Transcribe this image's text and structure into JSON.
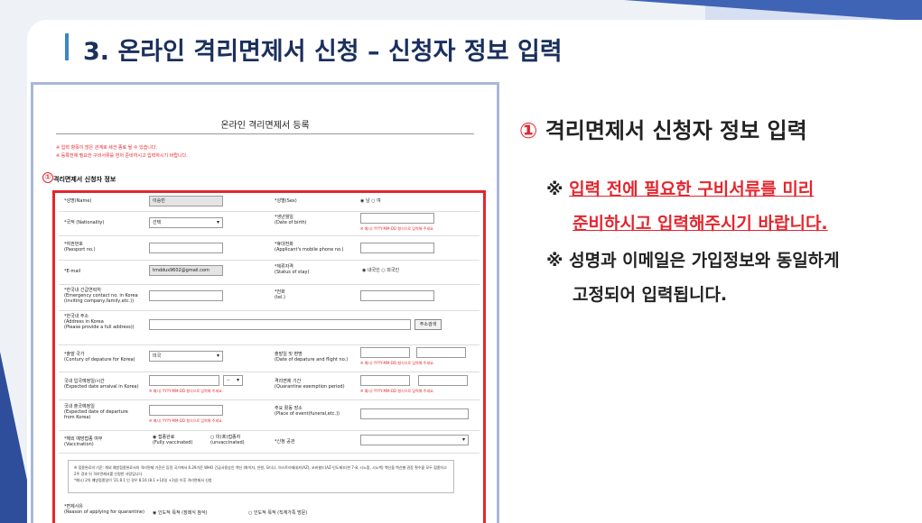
{
  "title": "3. 온라인 격리면제서 신청 – 신청자 정보 입력",
  "form": {
    "title": "온라인 격리면제서 등록",
    "notice1": "※ 입력 항목이 많은 관계로 세션 종료 될 수 있습니다.",
    "notice2": "※ 등록전에 필요한 구비서류를 먼저 준비하시고 입력하시기 바랍니다.",
    "marker": "①",
    "section_label": "격리면제서 신청자 정보",
    "name_label": "*성명(Name)",
    "name_value": "이승빈",
    "sex_label": "*성별(Sex)",
    "sex_options": "◉ 남 ○ 여",
    "nationality_label": "*국적 (Nationality)",
    "nationality_value": "선택",
    "birth_label": "*생년월일\n(Date of birth)",
    "date_hint": "※ 예시) YYYY-MM-DD 형식으로 입력해 주세요.",
    "passport_label": "*여권번호\n(Passport no.)",
    "mobile_label": "*휴대전화\n(Applicant's mobile phone no.)",
    "email_label": "*E-mail",
    "email_value": "tmddus9602@gmail.com",
    "stay_label": "*체류자격\n(Status of stay)",
    "stay_options": "◉ 내국인 ○ 외국인",
    "emergency_label": "*한국내 긴급연락처\n(Emergency contact no. in Korea\n(inviting company,family,etc.))",
    "tel_label": "*전화\n(tel.)",
    "address_label": "*한국내 주소\n(Address in Korea\n(Please provide a full address))",
    "address_button": "주소검색",
    "departure_country_label": "*출발 국가\n(Contury of depature for Korea)",
    "departure_country_value": "미국",
    "flight_label": "출발일 및 편명\n(Date of depature and flight no.)",
    "arrival_label": "국내 입국예정일/시간\n(Expected date arraival in Korea)",
    "time_value": "--",
    "quarantine_label": "격리면제 기간\n(Quarantine exemption period)",
    "departure_korea_label": "국내 출국예정일\n(Expected date of departure\nfrom Korea)",
    "event_label": "주요 활동 장소\n(Place of event(funeral,etc.))",
    "vaccine_label": "*해외 예방접종 여부\n(Vaccination)",
    "vaccinated_option": "◉ 접종완료\n(Fully vaccinated)",
    "unvaccinated_option": "○ 미(未)접종자\n(unvaccinated)",
    "agency_label": "*신청 공관",
    "vaccine_note": "※ 접종완료의 기준: 해외 예방접종완료서의 격리면제 기준은 등정 국가에서 6.29기준 WHO 긴급사용승인 백신 (화이자, 얀센, 모더나, 아스트라제네카(AZ), 코비쉴드(AZ-인도제조)한 7-8, 시노팜, 시노백) 백신을 백신별 권장 횟수을 모두 접종하고 2주 경과 뒤 격리면제서를 신청한 사람입니다.\n*예시) 2차 예방접종일이 '21.8.1 인 경우 8.16 (8.1 +14일 +1일) 이후 격리면제서 신청",
    "reason_label": "*면제사유\n(Reason of applying for quarantine)",
    "reason_option1": "◉ 인도적 목적 (장례식 참석)",
    "reason_option2": "○ 인도적 목적 (직계가족 방문)"
  },
  "right": {
    "num": "①",
    "heading": "격리면제서 신청자 정보 입력",
    "mark": "※",
    "bullet1_line1": "입력 전에 필요한 구비서류를 미리",
    "bullet1_line2": "준비하시고 입력해주시기 바랍니다.",
    "bullet2_line1": "성명과 이메일은 가입정보와 동일하게",
    "bullet2_line2": "고정되어 입력됩니다."
  },
  "colors": {
    "accent_red": "#e3262e",
    "title_blue": "#1a2f5c",
    "bar_blue": "#3a86c8"
  }
}
